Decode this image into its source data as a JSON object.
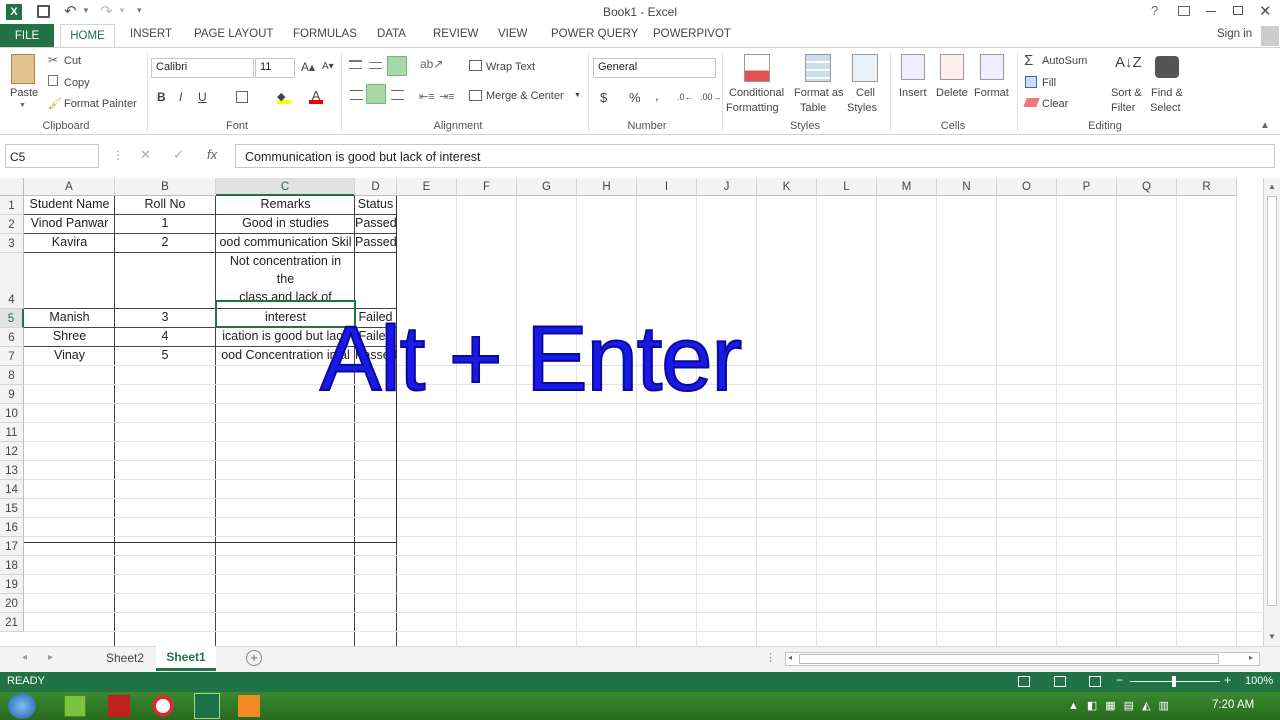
{
  "window": {
    "title": "Book1 - Excel",
    "sign_in": "Sign in"
  },
  "ribbon_tabs": [
    "FILE",
    "HOME",
    "INSERT",
    "PAGE LAYOUT",
    "FORMULAS",
    "DATA",
    "REVIEW",
    "VIEW",
    "POWER QUERY",
    "POWERPIVOT"
  ],
  "clipboard": {
    "paste": "Paste",
    "cut": "Cut",
    "copy": "Copy",
    "format_painter": "Format Painter",
    "group": "Clipboard"
  },
  "font": {
    "name": "Calibri",
    "size": "11",
    "bold": "B",
    "italic": "I",
    "underline": "U",
    "group": "Font"
  },
  "alignment": {
    "wrap": "Wrap Text",
    "merge": "Merge & Center",
    "group": "Alignment"
  },
  "number": {
    "format": "General",
    "currency": "$",
    "percent": "%",
    "comma": ",",
    "group": "Number"
  },
  "styles": {
    "conditional": "Conditional",
    "conditional2": "Formatting",
    "format_as": "Format as",
    "format_as2": "Table",
    "cell": "Cell",
    "cell2": "Styles",
    "group": "Styles"
  },
  "cells": {
    "insert": "Insert",
    "delete": "Delete",
    "format": "Format",
    "group": "Cells"
  },
  "editing": {
    "autosum": "AutoSum",
    "fill": "Fill",
    "clear": "Clear",
    "sort": "Sort &",
    "sort2": "Filter",
    "find": "Find &",
    "find2": "Select",
    "group": "Editing"
  },
  "formula_bar": {
    "name_box": "C5",
    "formula": "Communication is good but lack of interest"
  },
  "columns": [
    "A",
    "B",
    "C",
    "D",
    "E",
    "F",
    "G",
    "H",
    "I",
    "J",
    "K",
    "L",
    "M",
    "N",
    "O",
    "P",
    "Q",
    "R"
  ],
  "rows": [
    "1",
    "2",
    "3",
    "4",
    "5",
    "6",
    "7",
    "8",
    "9",
    "10",
    "11",
    "12",
    "13",
    "14",
    "15",
    "16",
    "17",
    "18",
    "19",
    "20",
    "21"
  ],
  "cells_data": {
    "a1": "Student Name",
    "b1": "Roll No",
    "c1": "Remarks",
    "d1": "Status",
    "a2": "Vinod Panwar",
    "b2": "1",
    "c2": "Good in studies",
    "d2": "Passed",
    "a3": "Kavira",
    "b3": "2",
    "c3": "ood communication Skil",
    "d3": "Passed",
    "c4_l1": "Not concentration in",
    "c4_l2": "the",
    "c4_l3": "class and lack of",
    "c4_l4": "interest",
    "a4": "Manish",
    "b4": "3",
    "d4": "Failed",
    "a5": "Shree",
    "b5": "4",
    "c5": "ication is good but lack",
    "d5": "Failed",
    "a6": "Vinay",
    "b6": "5",
    "c6": "ood Concentration in al",
    "d6": "Passed"
  },
  "sheet_tabs": [
    "Sheet2",
    "Sheet1"
  ],
  "status": {
    "ready": "READY",
    "zoom": "100%"
  },
  "taskbar": {
    "time": "7:20 AM"
  },
  "overlay": "Alt + Enter",
  "colors": {
    "excel_green": "#217346",
    "overlay_blue": "#1a1ae6"
  }
}
